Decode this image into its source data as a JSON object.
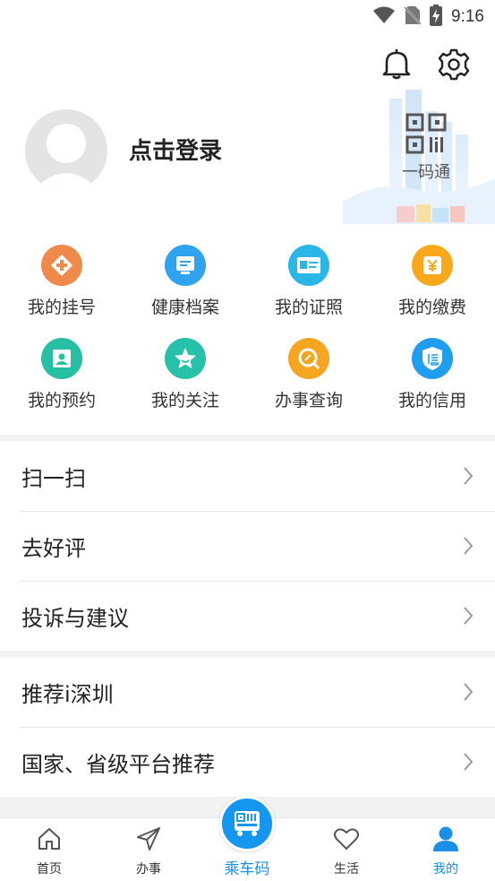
{
  "status_bar": {
    "time": "9:16"
  },
  "header": {
    "login_text": "点击登录",
    "qr_label": "一码通"
  },
  "grid": [
    {
      "label": "我的挂号",
      "icon": "plus-diamond-icon",
      "color": "#f08a4b"
    },
    {
      "label": "健康档案",
      "icon": "document-icon",
      "color": "#2fa3ee"
    },
    {
      "label": "我的证照",
      "icon": "id-card-icon",
      "color": "#2bb6e8"
    },
    {
      "label": "我的缴费",
      "icon": "yuan-icon",
      "color": "#f7a81b"
    },
    {
      "label": "我的预约",
      "icon": "appointment-icon",
      "color": "#27bfa3"
    },
    {
      "label": "我的关注",
      "icon": "star-icon",
      "color": "#27c0a8"
    },
    {
      "label": "办事查询",
      "icon": "search-icon",
      "color": "#f6a521"
    },
    {
      "label": "我的信用",
      "icon": "credit-shield-icon",
      "color": "#1f9ef0"
    }
  ],
  "menu1": [
    "扫一扫",
    "去好评",
    "投诉与建议"
  ],
  "menu2": [
    "推荐i深圳",
    "国家、省级平台推荐"
  ],
  "bottom_nav": {
    "home": "首页",
    "affairs": "办事",
    "bus_code": "乘车码",
    "life": "生活",
    "mine": "我的"
  },
  "colors": {
    "accent": "#1b8fe6"
  }
}
